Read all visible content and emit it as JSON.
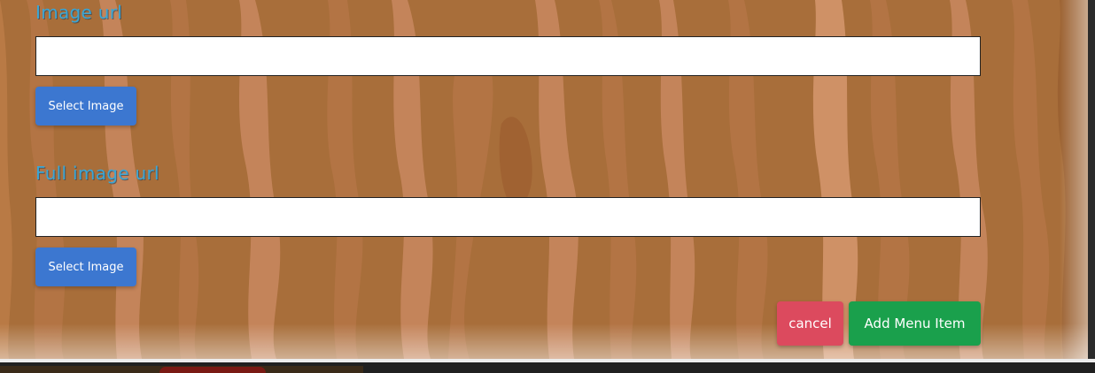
{
  "form": {
    "image_url": {
      "label": "Image url",
      "value": "",
      "select_label": "Select Image"
    },
    "full_image_url": {
      "label": "Full image url",
      "value": "",
      "select_label": "Select Image"
    }
  },
  "actions": {
    "cancel_label": "cancel",
    "submit_label": "Add Menu Item"
  },
  "colors": {
    "wood": "#a86e3a",
    "label": "#3aa6d6",
    "select_button": "#3c77d0",
    "cancel_button": "#dc4a5e",
    "submit_button": "#1aa04c"
  }
}
